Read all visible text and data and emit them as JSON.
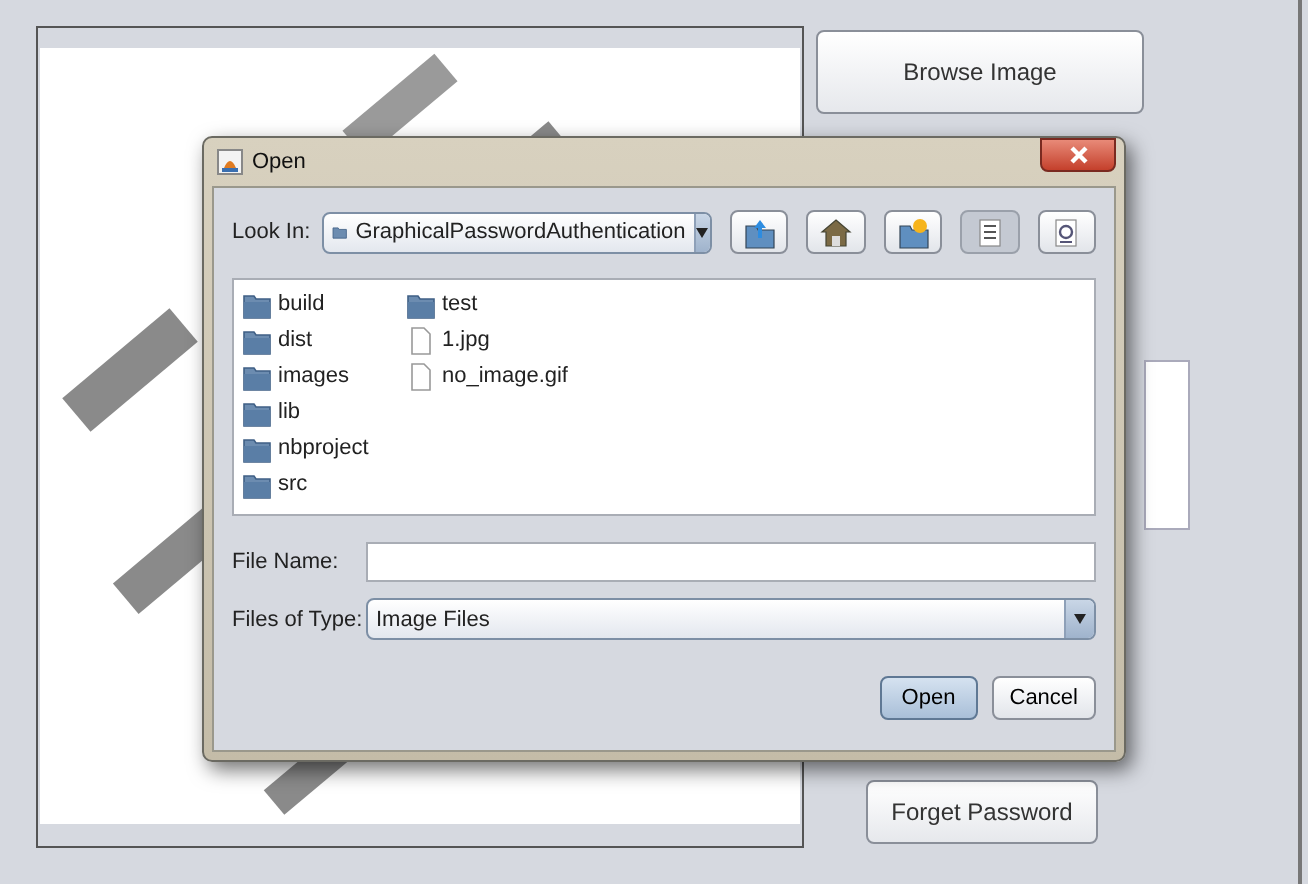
{
  "main_window": {
    "buttons": [
      {
        "label": "Browse Image"
      },
      {
        "label": "Forget Password"
      }
    ]
  },
  "open_dialog": {
    "title": "Open",
    "look_in": {
      "label": "Look In:",
      "value": "GraphicalPasswordAuthentication"
    },
    "toolbar": [
      {
        "kind": "up",
        "selected": false
      },
      {
        "kind": "home",
        "selected": false
      },
      {
        "kind": "new-folder",
        "selected": false
      },
      {
        "kind": "list",
        "selected": true
      },
      {
        "kind": "details",
        "selected": false
      }
    ],
    "files": [
      {
        "name": "build",
        "kind": "folder"
      },
      {
        "name": "dist",
        "kind": "folder"
      },
      {
        "name": "images",
        "kind": "folder"
      },
      {
        "name": "lib",
        "kind": "folder"
      },
      {
        "name": "nbproject",
        "kind": "folder"
      },
      {
        "name": "src",
        "kind": "folder"
      },
      {
        "name": "test",
        "kind": "folder"
      },
      {
        "name": "1.jpg",
        "kind": "file"
      },
      {
        "name": "no_image.gif",
        "kind": "file"
      }
    ],
    "file_name": {
      "label": "File Name:"
    },
    "file_type": {
      "label": "Files of Type:",
      "value": "Image Files"
    },
    "buttons": [
      {
        "label": "Open",
        "default": true
      },
      {
        "label": "Cancel",
        "default": false
      }
    ]
  }
}
